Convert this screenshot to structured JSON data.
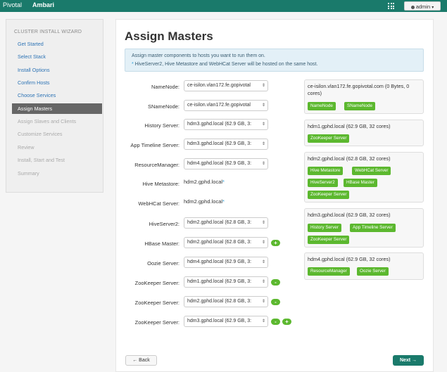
{
  "topbar": {
    "brand": "Pivotal",
    "product": "Ambari",
    "grid_icon": "grid-icon",
    "user": "admin",
    "color": "#1a7a6b"
  },
  "sidebar": {
    "title": "CLUSTER INSTALL WIZARD",
    "items": [
      {
        "label": "Get Started",
        "state": "link"
      },
      {
        "label": "Select Stack",
        "state": "link"
      },
      {
        "label": "Install Options",
        "state": "link"
      },
      {
        "label": "Confirm Hosts",
        "state": "link"
      },
      {
        "label": "Choose Services",
        "state": "link"
      },
      {
        "label": "Assign Masters",
        "state": "active"
      },
      {
        "label": "Assign Slaves and Clients",
        "state": "disabled"
      },
      {
        "label": "Customize Services",
        "state": "disabled"
      },
      {
        "label": "Review",
        "state": "disabled"
      },
      {
        "label": "Install, Start and Test",
        "state": "disabled"
      },
      {
        "label": "Summary",
        "state": "disabled"
      }
    ]
  },
  "main": {
    "title": "Assign Masters",
    "info_line1": "Assign master components to hosts you want to run them on.",
    "info_asterisk": "*",
    "info_line2": " HiveServer2, Hive Metastore and WebHCat Server will be hosted on the same host."
  },
  "assignments": [
    {
      "label": "NameNode:",
      "value": "ce-isilon.vlan172.fe.gopivotal",
      "type": "select"
    },
    {
      "label": "SNameNode:",
      "value": "ce-isilon.vlan172.fe.gopivotal",
      "type": "select"
    },
    {
      "label": "History Server:",
      "value": "hdm3.gphd.local (62.9 GB, 3:",
      "type": "select"
    },
    {
      "label": "App Timeline Server:",
      "value": "hdm3.gphd.local (62.9 GB, 3:",
      "type": "select"
    },
    {
      "label": "ResourceManager:",
      "value": "hdm4.gphd.local (62.9 GB, 3:",
      "type": "select"
    },
    {
      "label": "Hive Metastore:",
      "value": "hdm2.gphd.local",
      "type": "static"
    },
    {
      "label": "WebHCat Server:",
      "value": "hdm2.gphd.local",
      "type": "static"
    },
    {
      "label": "HiveServer2:",
      "value": "hdm2.gphd.local (62.8 GB, 3:",
      "type": "select"
    },
    {
      "label": "HBase Master:",
      "value": "hdm2.gphd.local (62.8 GB, 3:",
      "type": "select"
    },
    {
      "label": "Oozie Server:",
      "value": "hdm4.gphd.local (62.9 GB, 3:",
      "type": "select"
    },
    {
      "label": "ZooKeeper Server:",
      "value": "hdm1.gphd.local (62.9 GB, 3:",
      "type": "select"
    },
    {
      "label": "ZooKeeper Server:",
      "value": "hdm2.gphd.local (62.8 GB, 3:",
      "type": "select"
    },
    {
      "label": "ZooKeeper Server:",
      "value": "hdm3.gphd.local (62.9 GB, 3:",
      "type": "select"
    }
  ],
  "controls": {
    "plus": "+",
    "minus": "-",
    "asterisk": "*",
    "caret": "⇕"
  },
  "hosts": [
    {
      "name": "ce-isilon.vlan172.fe.gopivotal.com (0 Bytes, 0 cores)",
      "components": [
        "NameNode",
        "SNameNode"
      ]
    },
    {
      "name": "hdm1.gphd.local (62.9 GB, 32 cores)",
      "components": [
        "ZooKeeper Server"
      ]
    },
    {
      "name": "hdm2.gphd.local (62.8 GB, 32 cores)",
      "components": [
        "Hive Metastore",
        "WebHCat Server",
        "HiveServer2",
        "HBase Master",
        "ZooKeeper Server"
      ]
    },
    {
      "name": "hdm3.gphd.local (62.9 GB, 32 cores)",
      "components": [
        "History Server",
        "App Timeline Server",
        "ZooKeeper Server"
      ]
    },
    {
      "name": "hdm4.gphd.local (62.9 GB, 32 cores)",
      "components": [
        "ResourceManager",
        "Oozie Server"
      ]
    }
  ],
  "footer": {
    "back_label": "← Back",
    "next_label": "Next →"
  }
}
